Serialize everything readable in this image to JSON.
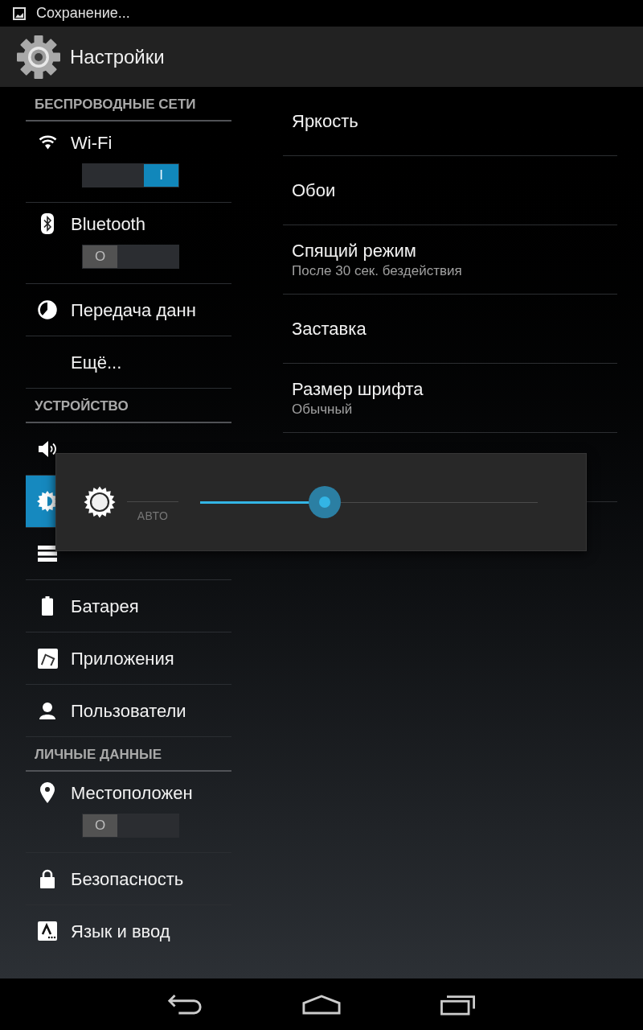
{
  "status_bar": {
    "notification": "Сохранение..."
  },
  "action_bar": {
    "title": "Настройки"
  },
  "sidebar": {
    "sections": [
      {
        "header": "БЕСПРОВОДНЫЕ СЕТИ",
        "items": [
          {
            "kind": "switch",
            "label": "Wi-Fi",
            "selected": false,
            "on": true,
            "switch_label": "I"
          },
          {
            "kind": "switch",
            "label": "Bluetooth",
            "selected": false,
            "on": false,
            "switch_label": "O"
          },
          {
            "kind": "plain",
            "label": "Передача данн",
            "selected": false
          },
          {
            "kind": "plain",
            "label": "Ещё...",
            "selected": false
          }
        ]
      },
      {
        "header": "УСТРОЙСТВО",
        "items": [
          {
            "kind": "plain",
            "selected": false
          },
          {
            "kind": "plain",
            "selected": true
          },
          {
            "kind": "plain",
            "selected": false
          },
          {
            "kind": "plain",
            "label": "Батарея",
            "selected": false
          },
          {
            "kind": "plain",
            "label": "Приложения",
            "selected": false
          },
          {
            "kind": "plain",
            "label": "Пользователи",
            "selected": false
          }
        ]
      },
      {
        "header": "ЛИЧНЫЕ ДАННЫЕ",
        "items": [
          {
            "kind": "switch",
            "label": "Местоположен",
            "selected": false,
            "on": false,
            "switch_label": "O"
          },
          {
            "kind": "plain",
            "label": "Безопасность",
            "selected": false
          },
          {
            "kind": "plain",
            "label": "Язык и ввод",
            "selected": false
          }
        ]
      }
    ]
  },
  "content": {
    "items": [
      {
        "title": "Яркость"
      },
      {
        "title": "Обои"
      },
      {
        "title": "Спящий режим",
        "summary": "После 30 сек. бездействия"
      },
      {
        "title": "Заставка"
      },
      {
        "title": "Размер шрифта",
        "summary": "Обычный"
      }
    ]
  },
  "brightness_dialog": {
    "auto": {
      "label": "АВТО",
      "on": false
    },
    "level": 0.37
  }
}
